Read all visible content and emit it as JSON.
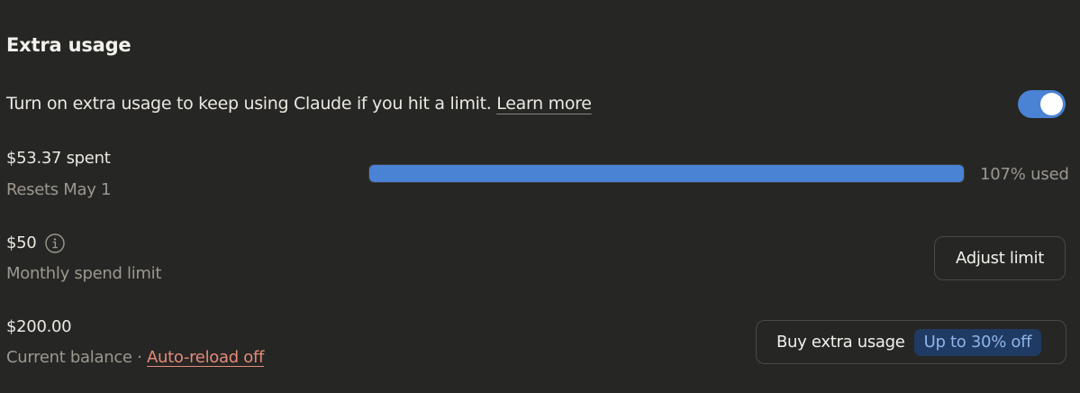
{
  "section": {
    "title": "Extra usage",
    "description": "Turn on extra usage to keep using Claude if you hit a limit.",
    "learn_more": "Learn more",
    "toggle_on": true
  },
  "usage": {
    "spent": "$53.37 spent",
    "resets": "Resets May 1",
    "used_label": "107% used",
    "used_fraction": 1.0
  },
  "limit": {
    "amount": "$50",
    "label": "Monthly spend limit",
    "button": "Adjust limit",
    "info_icon": "info-circle-icon"
  },
  "balance": {
    "amount": "$200.00",
    "label": "Current balance",
    "separator": "·",
    "auto_reload": "Auto-reload off",
    "buy_button": "Buy extra usage",
    "badge": "Up to 30% off"
  },
  "colors": {
    "background": "#262624",
    "accent": "#4a82d4",
    "link_warning": "#e58a7a",
    "badge_bg": "#1f3a63",
    "badge_text": "#8fb4e8"
  }
}
